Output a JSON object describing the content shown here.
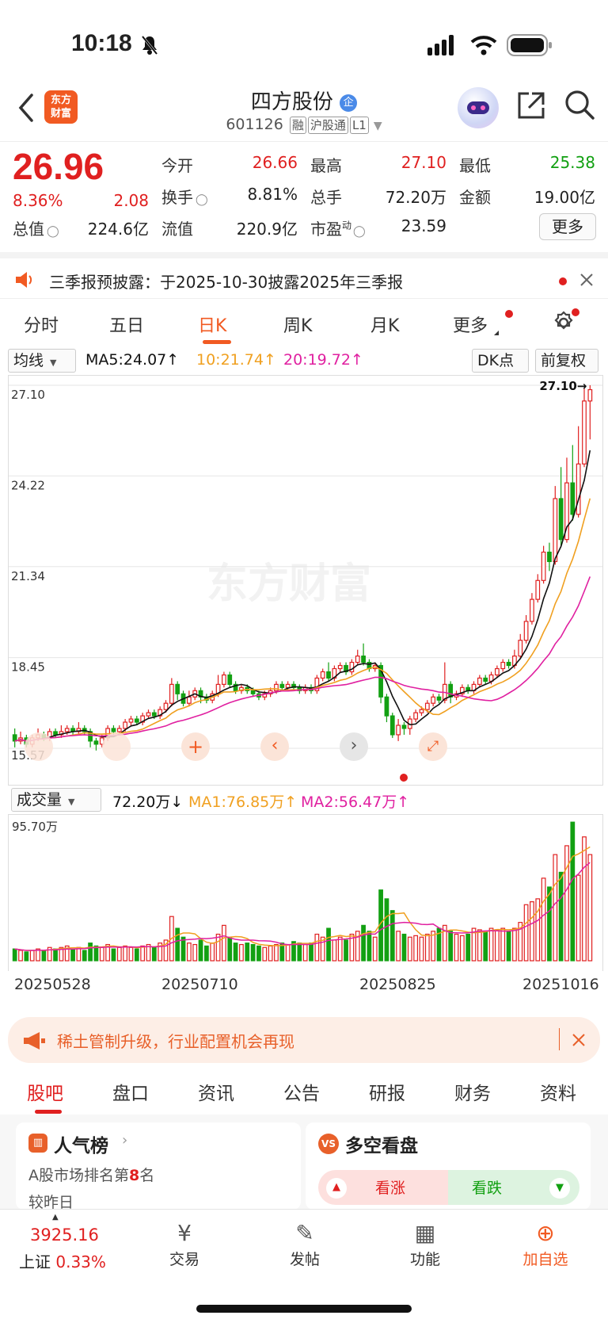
{
  "status": {
    "time": "10:18"
  },
  "header": {
    "logo_line1": "东方",
    "logo_line2": "财富",
    "title": "四方股份",
    "title_badge": "企",
    "code": "601126",
    "tags": [
      "融",
      "沪股通",
      "L1"
    ]
  },
  "quote": {
    "price": "26.96",
    "pct": "8.36%",
    "change": "2.08",
    "labels": {
      "open": "今开",
      "high": "最高",
      "low": "最低",
      "turnover": "换手",
      "volume": "总手",
      "amount": "金额",
      "total_cap": "总值",
      "float_cap": "流值",
      "pe": "市盈",
      "pe_sup": "动"
    },
    "values": {
      "open": "26.66",
      "high": "27.10",
      "low": "25.38",
      "turnover": "8.81%",
      "volume": "72.20万",
      "amount": "19.00亿",
      "total_cap": "224.6亿",
      "float_cap": "220.9亿",
      "pe": "23.59"
    },
    "more": "更多"
  },
  "notice": {
    "text": "三季报预披露：于2025-10-30披露2025年三季报"
  },
  "tabs": [
    "分时",
    "五日",
    "日K",
    "周K",
    "月K",
    "更多"
  ],
  "ma_bar": {
    "select": "均线",
    "ma5": "MA5:24.07",
    "ma10": "10:21.74",
    "ma20": "20:19.72",
    "dk": "DK点",
    "adjust": "前复权"
  },
  "colors": {
    "up": "#e02020",
    "down": "#12a012",
    "ma5": "#111111",
    "ma10": "#f0a020",
    "ma20": "#e020a0",
    "accent": "#f15a22"
  },
  "chart_data": {
    "type": "candlestick",
    "price_axis_labels": [
      "27.10",
      "24.22",
      "21.34",
      "18.45",
      "15.57"
    ],
    "price_range": [
      15.57,
      27.1
    ],
    "last_high_marker": "27.10",
    "watermark": "东方财富",
    "candles": [
      [
        16.0,
        15.8,
        16.2,
        15.6
      ],
      [
        15.8,
        15.9,
        16.1,
        15.7
      ],
      [
        15.9,
        15.7,
        16.0,
        15.6
      ],
      [
        15.7,
        15.9,
        16.0,
        15.6
      ],
      [
        15.9,
        16.0,
        16.2,
        15.8
      ],
      [
        16.0,
        15.9,
        16.1,
        15.8
      ],
      [
        15.9,
        16.1,
        16.2,
        15.8
      ],
      [
        16.1,
        16.0,
        16.2,
        15.9
      ],
      [
        16.0,
        16.1,
        16.3,
        15.9
      ],
      [
        16.1,
        16.2,
        16.3,
        16.0
      ],
      [
        16.2,
        16.1,
        16.3,
        16.0
      ],
      [
        16.1,
        16.2,
        16.4,
        16.0
      ],
      [
        16.2,
        16.1,
        16.3,
        16.0
      ],
      [
        16.1,
        15.8,
        16.2,
        15.6
      ],
      [
        15.8,
        15.7,
        15.9,
        15.5
      ],
      [
        15.7,
        15.9,
        16.0,
        15.6
      ],
      [
        15.9,
        16.2,
        16.3,
        15.8
      ],
      [
        16.2,
        16.1,
        16.3,
        16.0
      ],
      [
        16.1,
        16.2,
        16.3,
        16.0
      ],
      [
        16.2,
        16.4,
        16.5,
        16.1
      ],
      [
        16.4,
        16.5,
        16.6,
        16.3
      ],
      [
        16.5,
        16.4,
        16.6,
        16.3
      ],
      [
        16.4,
        16.6,
        16.7,
        16.3
      ],
      [
        16.6,
        16.7,
        16.8,
        16.5
      ],
      [
        16.7,
        16.6,
        16.8,
        16.5
      ],
      [
        16.6,
        16.8,
        16.9,
        16.5
      ],
      [
        16.8,
        17.0,
        17.1,
        16.7
      ],
      [
        17.0,
        17.6,
        17.8,
        16.9
      ],
      [
        17.6,
        17.3,
        17.7,
        17.1
      ],
      [
        17.3,
        17.0,
        17.4,
        16.9
      ],
      [
        17.0,
        17.2,
        17.4,
        16.9
      ],
      [
        17.2,
        17.4,
        17.5,
        17.1
      ],
      [
        17.4,
        17.2,
        17.5,
        17.0
      ],
      [
        17.2,
        17.1,
        17.3,
        17.0
      ],
      [
        17.1,
        17.3,
        17.4,
        17.0
      ],
      [
        17.3,
        17.6,
        17.9,
        17.2
      ],
      [
        17.6,
        17.9,
        18.0,
        17.5
      ],
      [
        17.9,
        17.6,
        18.0,
        17.5
      ],
      [
        17.6,
        17.4,
        17.7,
        17.3
      ],
      [
        17.4,
        17.5,
        17.6,
        17.3
      ],
      [
        17.5,
        17.4,
        17.6,
        17.3
      ],
      [
        17.4,
        17.3,
        17.5,
        17.2
      ],
      [
        17.3,
        17.2,
        17.4,
        17.1
      ],
      [
        17.2,
        17.3,
        17.4,
        17.1
      ],
      [
        17.3,
        17.4,
        17.5,
        17.2
      ],
      [
        17.4,
        17.6,
        17.7,
        17.3
      ],
      [
        17.6,
        17.5,
        17.7,
        17.4
      ],
      [
        17.5,
        17.6,
        17.7,
        17.4
      ],
      [
        17.6,
        17.5,
        17.7,
        17.4
      ],
      [
        17.5,
        17.4,
        17.6,
        17.3
      ],
      [
        17.4,
        17.5,
        17.6,
        17.3
      ],
      [
        17.5,
        17.4,
        17.6,
        17.3
      ],
      [
        17.4,
        17.8,
        17.9,
        17.3
      ],
      [
        17.8,
        18.0,
        18.1,
        17.7
      ],
      [
        18.0,
        17.8,
        18.3,
        17.7
      ],
      [
        17.8,
        18.1,
        18.2,
        17.7
      ],
      [
        18.1,
        18.2,
        18.3,
        18.0
      ],
      [
        18.2,
        18.0,
        18.3,
        17.9
      ],
      [
        18.0,
        18.3,
        18.4,
        17.9
      ],
      [
        18.3,
        18.5,
        18.7,
        18.2
      ],
      [
        18.5,
        18.3,
        18.9,
        18.2
      ],
      [
        18.3,
        18.1,
        18.4,
        18.0
      ],
      [
        18.1,
        18.2,
        18.3,
        18.0
      ],
      [
        18.2,
        17.2,
        18.3,
        17.0
      ],
      [
        17.2,
        16.6,
        17.3,
        16.4
      ],
      [
        16.6,
        16.0,
        16.7,
        15.9
      ],
      [
        16.0,
        16.3,
        16.5,
        15.8
      ],
      [
        16.3,
        16.2,
        16.4,
        16.0
      ],
      [
        16.2,
        16.5,
        16.6,
        16.0
      ],
      [
        16.5,
        16.7,
        16.8,
        16.4
      ],
      [
        16.7,
        16.8,
        16.9,
        16.6
      ],
      [
        16.8,
        17.0,
        17.1,
        16.7
      ],
      [
        17.0,
        17.2,
        17.3,
        16.9
      ],
      [
        17.2,
        17.1,
        17.3,
        17.0
      ],
      [
        17.1,
        17.6,
        18.3,
        17.0
      ],
      [
        17.6,
        17.2,
        17.7,
        17.0
      ],
      [
        17.2,
        17.3,
        17.4,
        17.1
      ],
      [
        17.3,
        17.5,
        17.6,
        17.2
      ],
      [
        17.5,
        17.4,
        17.6,
        17.3
      ],
      [
        17.4,
        17.6,
        17.7,
        17.3
      ],
      [
        17.6,
        17.8,
        17.9,
        17.5
      ],
      [
        17.8,
        17.7,
        17.9,
        17.6
      ],
      [
        17.7,
        17.9,
        18.0,
        17.6
      ],
      [
        17.9,
        18.1,
        18.2,
        17.8
      ],
      [
        18.1,
        18.3,
        18.4,
        18.0
      ],
      [
        18.3,
        18.2,
        18.4,
        18.1
      ],
      [
        18.2,
        18.5,
        18.7,
        18.1
      ],
      [
        18.5,
        19.0,
        19.2,
        18.4
      ],
      [
        19.0,
        19.6,
        19.8,
        18.9
      ],
      [
        19.6,
        20.3,
        20.5,
        19.5
      ],
      [
        20.3,
        20.9,
        21.1,
        20.2
      ],
      [
        20.9,
        21.8,
        22.0,
        20.8
      ],
      [
        21.8,
        21.5,
        22.1,
        21.2
      ],
      [
        21.5,
        23.5,
        23.9,
        21.4
      ],
      [
        23.5,
        22.2,
        24.5,
        22.0
      ],
      [
        22.2,
        24.0,
        24.8,
        22.1
      ],
      [
        24.0,
        23.0,
        25.2,
        22.8
      ],
      [
        23.0,
        24.6,
        25.8,
        22.9
      ],
      [
        24.6,
        26.6,
        27.0,
        24.5
      ],
      [
        26.6,
        26.96,
        27.1,
        25.38
      ]
    ],
    "volume_axis_label": "95.70万",
    "volume_range": [
      0,
      95.7
    ],
    "volumes": [
      8,
      7,
      6,
      7,
      8,
      7,
      9,
      8,
      9,
      10,
      8,
      9,
      7,
      12,
      10,
      9,
      11,
      8,
      9,
      10,
      9,
      8,
      10,
      11,
      9,
      12,
      14,
      30,
      22,
      16,
      12,
      11,
      14,
      10,
      12,
      18,
      24,
      16,
      12,
      11,
      12,
      11,
      10,
      9,
      10,
      11,
      12,
      11,
      13,
      12,
      11,
      12,
      18,
      16,
      22,
      14,
      16,
      14,
      18,
      20,
      24,
      20,
      16,
      48,
      42,
      34,
      20,
      18,
      16,
      17,
      16,
      18,
      20,
      22,
      24,
      20,
      18,
      17,
      18,
      22,
      21,
      20,
      22,
      21,
      22,
      20,
      22,
      26,
      38,
      40,
      42,
      56,
      50,
      72,
      60,
      78,
      94,
      58,
      84,
      72
    ],
    "vol_ma_labels": {
      "select": "成交量",
      "value": "72.20万",
      "ma1": "MA1:76.85万",
      "ma2": "MA2:56.47万"
    },
    "dates": [
      "20250528",
      "20250710",
      "20250825",
      "20251016"
    ]
  },
  "banner": {
    "text": "稀土管制升级，行业配置机会再现"
  },
  "bottom_tabs": [
    "股吧",
    "盘口",
    "资讯",
    "公告",
    "研报",
    "财务",
    "资料"
  ],
  "cards": {
    "popularity_title": "人气榜",
    "popularity_rank_prefix": "A股市场排名第",
    "popularity_rank": "8",
    "popularity_rank_suffix": "名",
    "popularity_extra": "较昨日",
    "vs_title": "多空看盘",
    "bull": "看涨",
    "bear": "看跌"
  },
  "index": {
    "value": "3925.16",
    "name": "上证",
    "pct": "0.33%"
  },
  "bottom_nav": [
    {
      "label": "交易",
      "icon": "yen-icon"
    },
    {
      "label": "发帖",
      "icon": "edit-icon"
    },
    {
      "label": "功能",
      "icon": "grid-icon"
    },
    {
      "label": "加自选",
      "icon": "plus-circle-icon"
    }
  ]
}
